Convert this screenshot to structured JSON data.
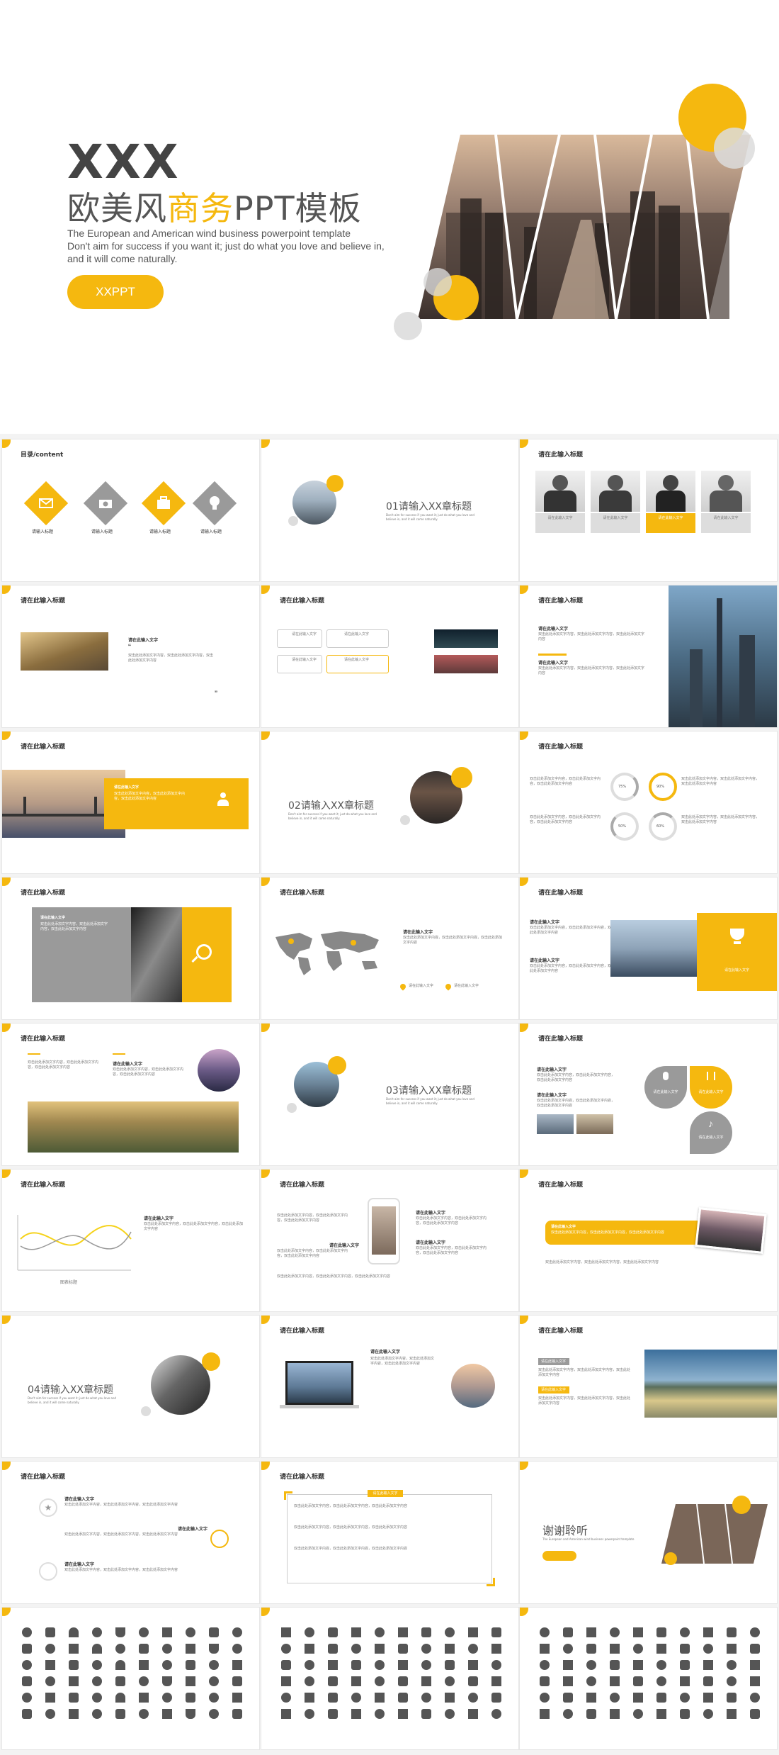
{
  "cover": {
    "title_top": "XXX",
    "title_main_a": "欧美风",
    "title_main_b": "商务",
    "title_main_c": "PPT模板",
    "subtitle_line1": "The European and American wind business powerpoint template",
    "subtitle_line2": "Don't aim for success if you want it; just do what you love and believe in, and it will come naturally.",
    "button_label": "XXPPT"
  },
  "colors": {
    "accent": "#f5b80f",
    "gray": "#9a9a9a",
    "text": "#555555"
  },
  "slides": {
    "toc": {
      "title": "目录/content",
      "items": [
        "请输入标题",
        "请输入标题",
        "请输入标题",
        "请输入标题"
      ],
      "icons": [
        "mail-icon",
        "camera-icon",
        "briefcase-icon",
        "lightbulb-icon"
      ]
    },
    "ch1": {
      "label": "01请输入XX章标题",
      "desc": "Don't aim for success if you want it; just do what you love and believe in, and it will come naturally."
    },
    "ch2": {
      "label": "02请输入XX章标题",
      "desc": "Don't aim for success if you want it; just do what you love and believe in, and it will come naturally."
    },
    "ch3": {
      "label": "03请输入XX章标题",
      "desc": "Don't aim for success if you want it; just do what you love and believe in, and it will come naturally."
    },
    "ch4": {
      "label": "04请输入XX章标题",
      "desc": "Don't aim for success if you want it; just do what you love and believe in, and it will come naturally."
    },
    "heading": "请在此输入标题",
    "text_label": "请在此输入文字",
    "body_text": "双击此处添加文字内容，双击此处添加文字内容，双击此处添加文字内容",
    "percents": [
      "75%",
      "90%",
      "50%",
      "60%"
    ],
    "chart_label": "图表标题",
    "thanks": {
      "title": "谢谢聆听",
      "sub": "The European and American wind business powerpoint template"
    }
  }
}
